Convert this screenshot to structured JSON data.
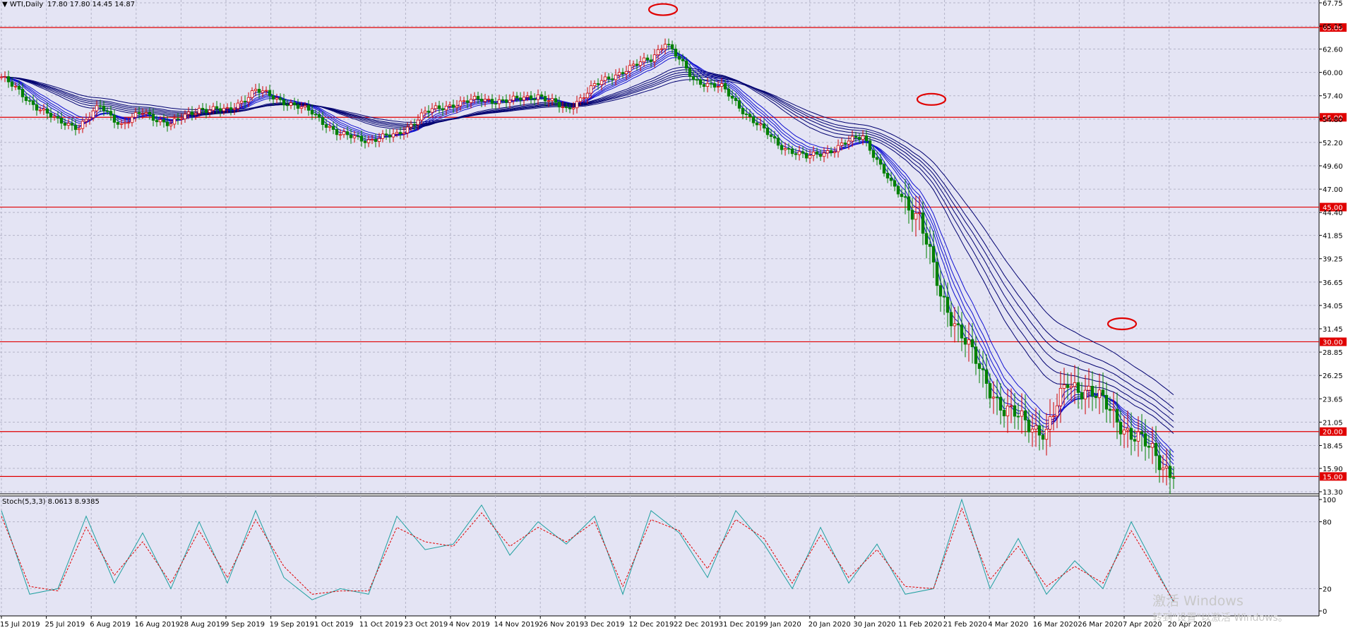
{
  "header": {
    "symbol_label": "▼ WTI,Daily",
    "ohlc": "17.80 17.80 14.45 14.87"
  },
  "indicator": {
    "label": "Stoch(5,3,3) 8.0613 8.9385"
  },
  "watermark": {
    "line1": "激活 Windows",
    "line2": "转到\"设置\"以激活 Windows。"
  },
  "colors": {
    "background": "#e4e4f4",
    "grid": "#b4b4c8",
    "resistance": "#e00000",
    "ema_blue": "#1010d0",
    "ema_navy": "#000070",
    "bull_body": "#ffffff",
    "bull_wick": "#d00000",
    "bear_body": "#008000",
    "stoch_main": "#20a0a0",
    "stoch_signal": "#e00000"
  },
  "chart_data": [
    {
      "type": "candlestick",
      "title": "WTI,Daily",
      "ylim": [
        13.3,
        67.75
      ],
      "yticks": [
        "67.75",
        "65.15",
        "62.60",
        "60.00",
        "57.40",
        "54.80",
        "52.20",
        "49.60",
        "47.00",
        "44.40",
        "41.85",
        "39.25",
        "36.65",
        "34.05",
        "31.45",
        "28.85",
        "26.25",
        "23.65",
        "21.05",
        "18.45",
        "15.90",
        "13.30"
      ],
      "xticks": [
        "15 Jul 2019",
        "25 Jul 2019",
        "6 Aug 2019",
        "16 Aug 2019",
        "28 Aug 2019",
        "9 Sep 2019",
        "19 Sep 2019",
        "1 Oct 2019",
        "11 Oct 2019",
        "23 Oct 2019",
        "4 Nov 2019",
        "14 Nov 2019",
        "26 Nov 2019",
        "3 Dec 2019",
        "12 Dec 2019",
        "22 Dec 2019",
        "31 Dec 2019",
        "9 Jan 2020",
        "20 Jan 2020",
        "30 Jan 2020",
        "11 Feb 2020",
        "21 Feb 2020",
        "4 Mar 2020",
        "16 Mar 2020",
        "26 Mar 2020",
        "7 Apr 2020",
        "20 Apr 2020"
      ],
      "horizontal_levels": [
        {
          "value": 65.0,
          "label": "65.00"
        },
        {
          "value": 55.0,
          "label": "55.00"
        },
        {
          "value": 45.0,
          "label": "45.00"
        },
        {
          "value": 30.0,
          "label": "30.00"
        },
        {
          "value": 20.0,
          "label": "20.00"
        },
        {
          "value": 15.0,
          "label": "15.00"
        }
      ],
      "close_path": {
        "x_index": [
          0,
          8,
          16,
          22,
          28,
          34,
          40,
          48,
          56,
          64,
          72,
          80,
          88,
          96,
          104,
          112,
          120,
          128,
          136,
          144,
          152,
          160,
          168,
          176,
          184,
          188,
          196,
          204,
          212,
          220,
          228,
          236,
          244,
          252,
          260,
          266,
          272,
          278,
          284,
          290,
          296,
          302,
          308,
          314,
          320,
          326,
          332
        ],
        "close": [
          59.5,
          56.8,
          54.5,
          54.0,
          56.2,
          54.2,
          55.5,
          54.2,
          56.0,
          55.7,
          58.0,
          56.8,
          55.5,
          53.0,
          52.5,
          53.0,
          55.5,
          56.5,
          57.0,
          56.8,
          57.5,
          55.8,
          58.5,
          60.2,
          61.5,
          63.5,
          59.2,
          58.3,
          55.0,
          52.0,
          50.5,
          51.5,
          53.0,
          47.5,
          44.0,
          35.0,
          31.0,
          26.0,
          22.5,
          21.0,
          20.0,
          25.5,
          24.5,
          22.5,
          19.5,
          18.0,
          14.87
        ]
      },
      "markers": [
        {
          "label": "top-ellipse-jan",
          "value": 65.0
        },
        {
          "label": "top-ellipse-feb",
          "value": 55.0
        },
        {
          "label": "top-ellipse-apr",
          "value": 30.0
        }
      ]
    },
    {
      "type": "line",
      "title": "Stoch(5,3,3) 8.0613 8.9385",
      "ylim": [
        0,
        100
      ],
      "yticks": [
        "100",
        "80",
        "20",
        "0"
      ],
      "series": [
        {
          "name": "main",
          "x_index": [
            0,
            8,
            16,
            24,
            32,
            40,
            48,
            56,
            64,
            72,
            80,
            88,
            96,
            104,
            112,
            120,
            128,
            136,
            144,
            152,
            160,
            168,
            176,
            184,
            192,
            200,
            208,
            216,
            224,
            232,
            240,
            248,
            256,
            264,
            272,
            280,
            288,
            296,
            304,
            312,
            320,
            332
          ],
          "values": [
            90,
            15,
            20,
            85,
            25,
            70,
            20,
            80,
            25,
            90,
            30,
            10,
            20,
            15,
            85,
            55,
            60,
            95,
            50,
            80,
            60,
            85,
            15,
            90,
            70,
            30,
            90,
            60,
            20,
            75,
            25,
            60,
            15,
            20,
            100,
            20,
            65,
            15,
            45,
            20,
            80,
            8
          ]
        },
        {
          "name": "signal",
          "x_index": [
            0,
            8,
            16,
            24,
            32,
            40,
            48,
            56,
            64,
            72,
            80,
            88,
            96,
            104,
            112,
            120,
            128,
            136,
            144,
            152,
            160,
            168,
            176,
            184,
            192,
            200,
            208,
            216,
            224,
            232,
            240,
            248,
            256,
            264,
            272,
            280,
            288,
            296,
            304,
            312,
            320,
            332
          ],
          "values": [
            85,
            22,
            18,
            75,
            32,
            62,
            25,
            72,
            30,
            82,
            40,
            15,
            18,
            18,
            75,
            62,
            58,
            88,
            58,
            75,
            62,
            80,
            22,
            82,
            72,
            38,
            82,
            65,
            25,
            68,
            30,
            55,
            22,
            20,
            92,
            28,
            58,
            22,
            40,
            25,
            72,
            9
          ]
        }
      ]
    }
  ]
}
